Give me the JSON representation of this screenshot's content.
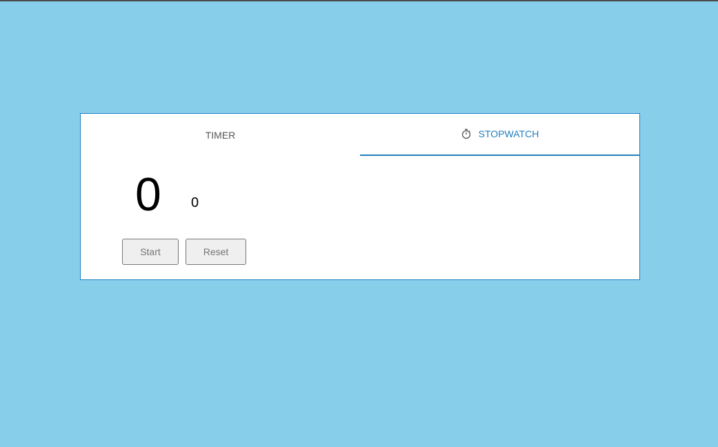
{
  "tabs": {
    "timer_label": "TIMER",
    "stopwatch_label": "STOPWATCH",
    "active": "stopwatch"
  },
  "stopwatch": {
    "main_value": "0",
    "sub_value": "0"
  },
  "controls": {
    "start_label": "Start",
    "reset_label": "Reset"
  },
  "icons": {
    "stopwatch": "stopwatch-icon"
  },
  "colors": {
    "background": "#87ceeb",
    "accent": "#1f7fc0",
    "card": "#ffffff",
    "button_bg": "#efefef",
    "button_text": "#757575"
  }
}
